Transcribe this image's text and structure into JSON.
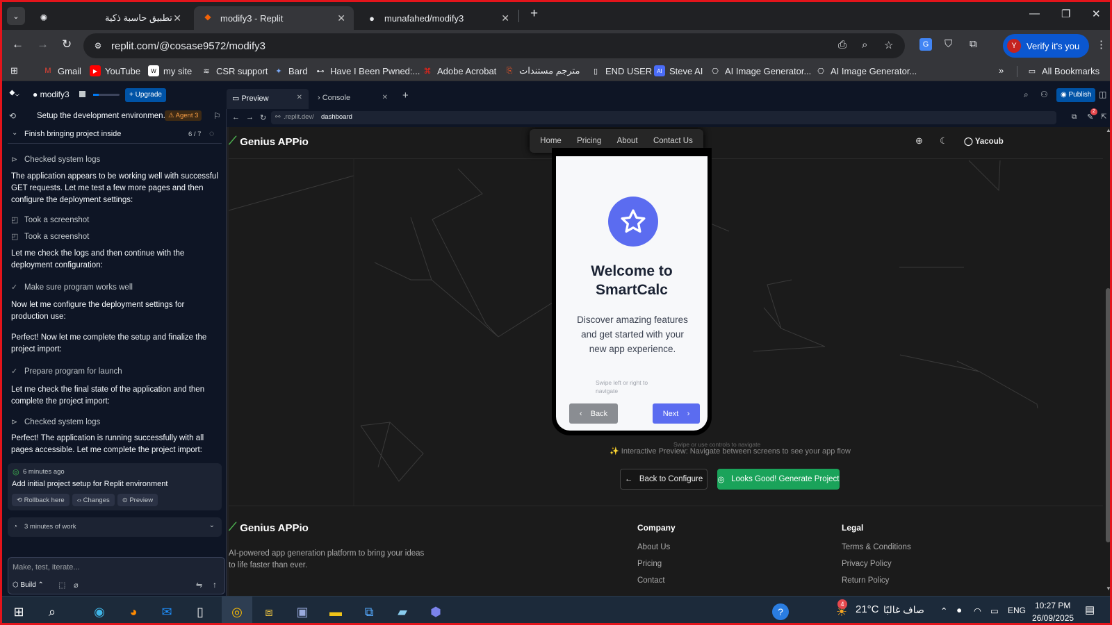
{
  "browser": {
    "tabs": [
      {
        "title": "تطبيق حاسبة ذكية",
        "active": false
      },
      {
        "title": "modify3 - Replit",
        "active": true
      },
      {
        "title": "munafahed/modify3",
        "active": false
      }
    ],
    "url": "replit.com/@cosase9572/modify3",
    "verify_label": "Verify it's you",
    "profile_initial": "Y",
    "bookmarks": [
      "Gmail",
      "YouTube",
      "my site",
      "CSR support",
      "Bard",
      "Have I Been Pwned:...",
      "Adobe Acrobat",
      "مترجم مستندات",
      "END USER",
      "Steve AI",
      "AI Image Generator...",
      "AI Image Generator..."
    ],
    "all_bookmarks": "All Bookmarks",
    "accent": "#0b57d0"
  },
  "replit": {
    "project_name": "modify3",
    "upgrade_label": "Upgrade",
    "chat_title": "Setup the development environmen...",
    "agent_badge": "Agent 3",
    "progress_label": "Finish bringing project inside",
    "progress_count": "6 / 7",
    "preview_tab": "Preview",
    "console_tab": "Console",
    "preview_url_prefix": ".replit.dev/",
    "preview_url_path": "dashboard",
    "publish_label": "Publish",
    "notification_count": "2",
    "log": [
      {
        "kind": "item",
        "icon": "terminal-icon",
        "text": "Checked system logs"
      },
      {
        "kind": "text",
        "text": "The application appears to be working well with successful GET requests. Let me test a few more pages and then configure the deployment settings:"
      },
      {
        "kind": "item",
        "icon": "camera-icon",
        "text": "Took a screenshot"
      },
      {
        "kind": "item",
        "icon": "camera-icon",
        "text": "Took a screenshot"
      },
      {
        "kind": "text",
        "text": "Let me check the logs and then continue with the deployment configuration:"
      },
      {
        "kind": "item",
        "icon": "check-icon",
        "text": "Make sure program works well"
      },
      {
        "kind": "text",
        "text": "Now let me configure the deployment settings for production use:"
      },
      {
        "kind": "text",
        "text": "Perfect! Now let me complete the setup and finalize the project import:"
      },
      {
        "kind": "item",
        "icon": "check-icon",
        "text": "Prepare program for launch"
      },
      {
        "kind": "text",
        "text": "Let me check the final state of the application and then complete the project import:"
      },
      {
        "kind": "item",
        "icon": "terminal-icon",
        "text": "Checked system logs"
      },
      {
        "kind": "text",
        "text": "Perfect! The application is running successfully with all pages accessible. Let me complete the project import:"
      }
    ],
    "checkpoint": {
      "time": "6 minutes ago",
      "title": "Add initial project setup for Replit environment",
      "actions": [
        "Rollback here",
        "Changes",
        "Preview"
      ]
    },
    "work_summary": "3 minutes of work",
    "input_placeholder": "Make, test, iterate...",
    "build_label": "Build"
  },
  "app": {
    "brand": "Genius APPio",
    "nav": [
      "Home",
      "Pricing",
      "About",
      "Contact Us"
    ],
    "user": "Yacoub",
    "phone": {
      "title": "Welcome to SmartCalc",
      "description": "Discover amazing features and get started with your new app experience.",
      "hint": "Swipe left or right to navigate",
      "back": "Back",
      "next": "Next"
    },
    "swipe_hint": "Swipe or use controls to navigate",
    "interactive_note": "Interactive Preview: Navigate between screens to see your app flow",
    "back_to_configure": "Back to Configure",
    "generate": "Looks Good! Generate Project",
    "footer": {
      "tagline": "AI-powered app generation platform to bring your ideas to life faster than ever.",
      "company_heading": "Company",
      "company_links": [
        "About Us",
        "Pricing",
        "Contact"
      ],
      "legal_heading": "Legal",
      "legal_links": [
        "Terms & Conditions",
        "Privacy Policy",
        "Return Policy"
      ]
    },
    "accent": "#5b6cf0",
    "success": "#1aa35a"
  },
  "taskbar": {
    "temperature": "21°C",
    "weather_text": "صاف غالبًا",
    "weather_badge": "4",
    "language": "ENG",
    "time": "10:27 PM",
    "date": "26/09/2025"
  }
}
